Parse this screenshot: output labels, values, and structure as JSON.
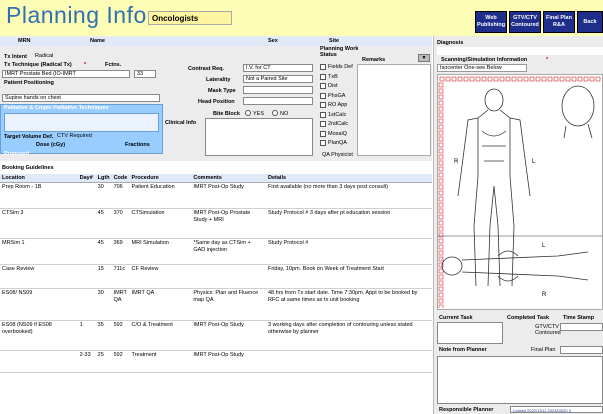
{
  "header": {
    "title": "Planning Info",
    "specialty": "Oncologists",
    "nav": [
      "Web Publishing",
      "GTV/CTV Contoured",
      "Final Plan R&A",
      "Back"
    ]
  },
  "patient": {
    "mrn_label": "MRN",
    "name_label": "Name",
    "sex_label": "Sex",
    "site_label": "Site",
    "tx_intent_label": "Tx Intent",
    "tx_intent_value": "Radical",
    "tx_technique_label": "Tx Technique (Radical Tx)",
    "required_marker": "*",
    "fctns_label": "Fctns.",
    "tx_technique_value": "IMRT Prostate Bed (IO-IMRT",
    "fctns_value": "33",
    "positioning_label": "Patient Positioning",
    "positioning_value": "Supine hands on chest",
    "palliative_label": "Palliative & Cmplx Palliative Techniques",
    "target_label": "Target Volume Def.",
    "target_value": "CTV Required",
    "dose_label": "Dose (cGy)",
    "fractions_label": "Fractions",
    "proposed_label": "Proposed"
  },
  "contrast": {
    "contrast_label": "Contrast Req.",
    "contrast_value": "I.V. for CT",
    "laterality_label": "Laterality",
    "laterality_value": "Not a Paired Site",
    "mask_label": "Mask Type",
    "head_label": "Head Position",
    "bite_label": "Bite Block",
    "yes": "YES",
    "no": "NO",
    "clinical_label": "Clinical Info"
  },
  "workstatus": {
    "title": "Planning Work Status",
    "remarks": "Remarks",
    "items": [
      "Fields Def",
      "TxB",
      "Dist",
      "PhsGA",
      "RO App",
      "1stCalc",
      "2ndCalc",
      "MosaiQ",
      "PlanQA"
    ],
    "qa_label": "QA Physicist"
  },
  "booking": {
    "title": "Booking Guidelines",
    "columns": [
      "Location",
      "Day#",
      "Lgth",
      "Code",
      "Procedure",
      "Comments",
      "Details"
    ],
    "rows": [
      [
        "Prep Room - 1B",
        "",
        "30",
        "706",
        "Patient Education",
        "IMRT Post-Op Study",
        "First available (no more than 3 days post consult)"
      ],
      [
        "CTSim 3",
        "",
        "45",
        "370",
        "CTSimulation",
        "IMRT Post-Op Prostate Study + MRI",
        "Study Protocol # 3 days after pt education session"
      ],
      [
        "MRSim 1",
        "",
        "45",
        "369",
        "MRI Simulation",
        "*Same day as CTSim + GAD injection",
        "Study Protocol #"
      ],
      [
        "Case Review",
        "",
        "15",
        "711c",
        "CF Review",
        "",
        "Friday, 10pm. Book on Week of Treatment Start"
      ],
      [
        "ES08/ NS09",
        "",
        "30",
        "IMRT QA",
        "IMRT QA",
        "Physics: Plan and Fluence map QA",
        "48 hrs from Tx start date. Time 7:30pm. Appt to be booked by RFC at same times as tx unit booking"
      ],
      [
        "ES08 (NS09 if ES08 overbooked)",
        "1",
        "35",
        "592",
        "C/O & Treatment",
        "IMRT Post-Op Study",
        "3 working days after completion of contouring unless stated otherwise by planner"
      ],
      [
        "",
        "2-33",
        "25",
        "592",
        "Treatment",
        "IMRT Post-Op Study",
        ""
      ]
    ]
  },
  "right": {
    "diagnosis_label": "Diagnosis",
    "scan_label": "Scanning/Simulation Information",
    "scan_value": "Isocenter One-see Below",
    "body_r": "R",
    "body_l": "L",
    "current_task": "Current Task",
    "completed_task": "Completed Task",
    "time_stamp": "Time Stamp",
    "gtv": "GTV/CTV Contoured",
    "final_plan": "Final Plan",
    "note_label": "Note from Planner",
    "responsible_label": "Responsible Planner",
    "responsible_value": "Locked 2022/11/11 2023/03/20 3"
  },
  "colors": {
    "title": "#2f6fb3",
    "topbar": "#fdfdb6",
    "nav": "#1f2e8a",
    "required": "#cc0000",
    "palliative": "#99ccff"
  }
}
